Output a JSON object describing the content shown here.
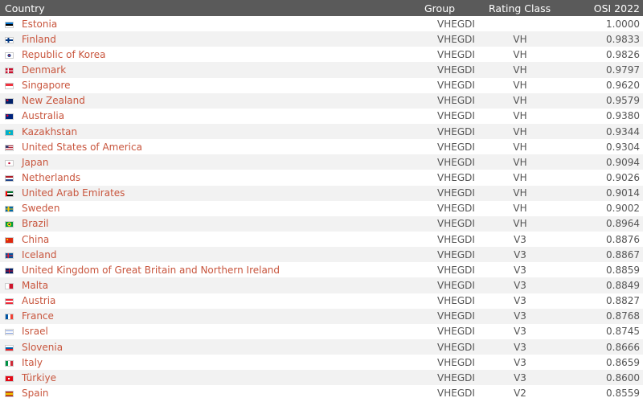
{
  "table": {
    "headers": {
      "country": "Country",
      "group": "Group",
      "rating_class": "Rating Class",
      "osi": "OSI 2022"
    },
    "rows": [
      {
        "country": "Estonia",
        "group": "VHEGDI",
        "rating": "",
        "osi": "1.0000",
        "flag": "linear-gradient(#0072ce 33%, #000 33% 66%, #fff 66%)"
      },
      {
        "country": "Finland",
        "group": "VHEGDI",
        "rating": "VH",
        "osi": "0.9833",
        "flag": "linear-gradient(90deg, transparent 30%, #003580 30% 50%, transparent 50%), linear-gradient(#fff 35%, #003580 35% 65%, #fff 65%)"
      },
      {
        "country": "Republic of Korea",
        "group": "VHEGDI",
        "rating": "VH",
        "osi": "0.9826",
        "flag": "radial-gradient(circle at 50% 50%, #cd2e3a 0 22%, #0047a0 22% 38%, #fff 38%)"
      },
      {
        "country": "Denmark",
        "group": "VHEGDI",
        "rating": "VH",
        "osi": "0.9797",
        "flag": "linear-gradient(90deg, transparent 30%, #fff 30% 45%, transparent 45%), linear-gradient(#c8102e 40%, #fff 40% 60%, #c8102e 60%)"
      },
      {
        "country": "Singapore",
        "group": "VHEGDI",
        "rating": "VH",
        "osi": "0.9620",
        "flag": "linear-gradient(#ef3340 50%, #fff 50%)"
      },
      {
        "country": "New Zealand",
        "group": "VHEGDI",
        "rating": "VH",
        "osi": "0.9579",
        "flag": "radial-gradient(circle at 25% 30%, #c8102e 0 15%, transparent 16%), linear-gradient(#012169, #012169)"
      },
      {
        "country": "Australia",
        "group": "VHEGDI",
        "rating": "VH",
        "osi": "0.9380",
        "flag": "radial-gradient(circle at 25% 30%, #e4002b 0 15%, transparent 16%), linear-gradient(#00247d, #00247d)"
      },
      {
        "country": "Kazakhstan",
        "group": "VHEGDI",
        "rating": "VH",
        "osi": "0.9344",
        "flag": "radial-gradient(circle at 55% 50%, #fec50c 0 18%, transparent 20%), linear-gradient(#00afca, #00afca)"
      },
      {
        "country": "United States of America",
        "group": "VHEGDI",
        "rating": "VH",
        "osi": "0.9304",
        "flag": "linear-gradient(90deg, #3c3b6e 40%, transparent 40%) 0 0 / 100% 55% no-repeat, repeating-linear-gradient(#b22234 0 1px, #fff 1px 2px)"
      },
      {
        "country": "Japan",
        "group": "VHEGDI",
        "rating": "VH",
        "osi": "0.9094",
        "flag": "radial-gradient(circle at 50% 50%, #bc002d 0 22%, #fff 24%)"
      },
      {
        "country": "Netherlands",
        "group": "VHEGDI",
        "rating": "VH",
        "osi": "0.9026",
        "flag": "linear-gradient(#ae1c28 33%, #fff 33% 66%, #21468b 66%)"
      },
      {
        "country": "United Arab Emirates",
        "group": "VHEGDI",
        "rating": "VH",
        "osi": "0.9014",
        "flag": "linear-gradient(90deg, #ff0000 25%, transparent 25%), linear-gradient(#00732f 33%, #fff 33% 66%, #000 66%)"
      },
      {
        "country": "Sweden",
        "group": "VHEGDI",
        "rating": "VH",
        "osi": "0.9002",
        "flag": "linear-gradient(90deg, transparent 30%, #fecc00 30% 48%, transparent 48%), linear-gradient(#006aa7 38%, #fecc00 38% 62%, #006aa7 62%)"
      },
      {
        "country": "Brazil",
        "group": "VHEGDI",
        "rating": "VH",
        "osi": "0.8964",
        "flag": "radial-gradient(circle at 50% 50%, #002776 0 20%, #ffdf00 21% 45%, #009b3a 46%)"
      },
      {
        "country": "China",
        "group": "VHEGDI",
        "rating": "V3",
        "osi": "0.8876",
        "flag": "radial-gradient(circle at 25% 30%, #ffde00 0 12%, transparent 13%), linear-gradient(#de2910, #de2910)"
      },
      {
        "country": "Iceland",
        "group": "VHEGDI",
        "rating": "V3",
        "osi": "0.8867",
        "flag": "linear-gradient(90deg, transparent 30%, #dc1e35 30% 45%, transparent 45%), linear-gradient(#02529c 38%, #dc1e35 38% 62%, #02529c 62%)"
      },
      {
        "country": "United Kingdom of Great Britain and Northern Ireland",
        "group": "VHEGDI",
        "rating": "V3",
        "osi": "0.8859",
        "flag": "linear-gradient(90deg, transparent 42%, #c8102e 42% 58%, transparent 58%), linear-gradient(#012169 38%, #c8102e 38% 62%, #012169 62%)"
      },
      {
        "country": "Malta",
        "group": "VHEGDI",
        "rating": "V3",
        "osi": "0.8849",
        "flag": "linear-gradient(90deg, #fff 50%, #cf142b 50%)"
      },
      {
        "country": "Austria",
        "group": "VHEGDI",
        "rating": "V3",
        "osi": "0.8827",
        "flag": "linear-gradient(#ed2939 33%, #fff 33% 66%, #ed2939 66%)"
      },
      {
        "country": "France",
        "group": "VHEGDI",
        "rating": "V3",
        "osi": "0.8768",
        "flag": "linear-gradient(90deg, #0055a4 33%, #fff 33% 66%, #ef4135 66%)"
      },
      {
        "country": "Israel",
        "group": "VHEGDI",
        "rating": "V3",
        "osi": "0.8745",
        "flag": "linear-gradient(#fff 15%, #0038b8 15% 28%, #fff 28% 72%, #0038b8 72% 85%, #fff 85%)"
      },
      {
        "country": "Slovenia",
        "group": "VHEGDI",
        "rating": "V3",
        "osi": "0.8666",
        "flag": "linear-gradient(#fff 33%, #005da4 33% 66%, #ed1c24 66%)"
      },
      {
        "country": "Italy",
        "group": "VHEGDI",
        "rating": "V3",
        "osi": "0.8659",
        "flag": "linear-gradient(90deg, #009246 33%, #fff 33% 66%, #ce2b37 66%)"
      },
      {
        "country": "Türkiye",
        "group": "VHEGDI",
        "rating": "V3",
        "osi": "0.8600",
        "flag": "radial-gradient(circle at 45% 50%, #fff 0 20%, transparent 22%), linear-gradient(#e30a17, #e30a17)"
      },
      {
        "country": "Spain",
        "group": "VHEGDI",
        "rating": "V2",
        "osi": "0.8559",
        "flag": "linear-gradient(#aa151b 25%, #f1bf00 25% 75%, #aa151b 75%)"
      }
    ]
  }
}
